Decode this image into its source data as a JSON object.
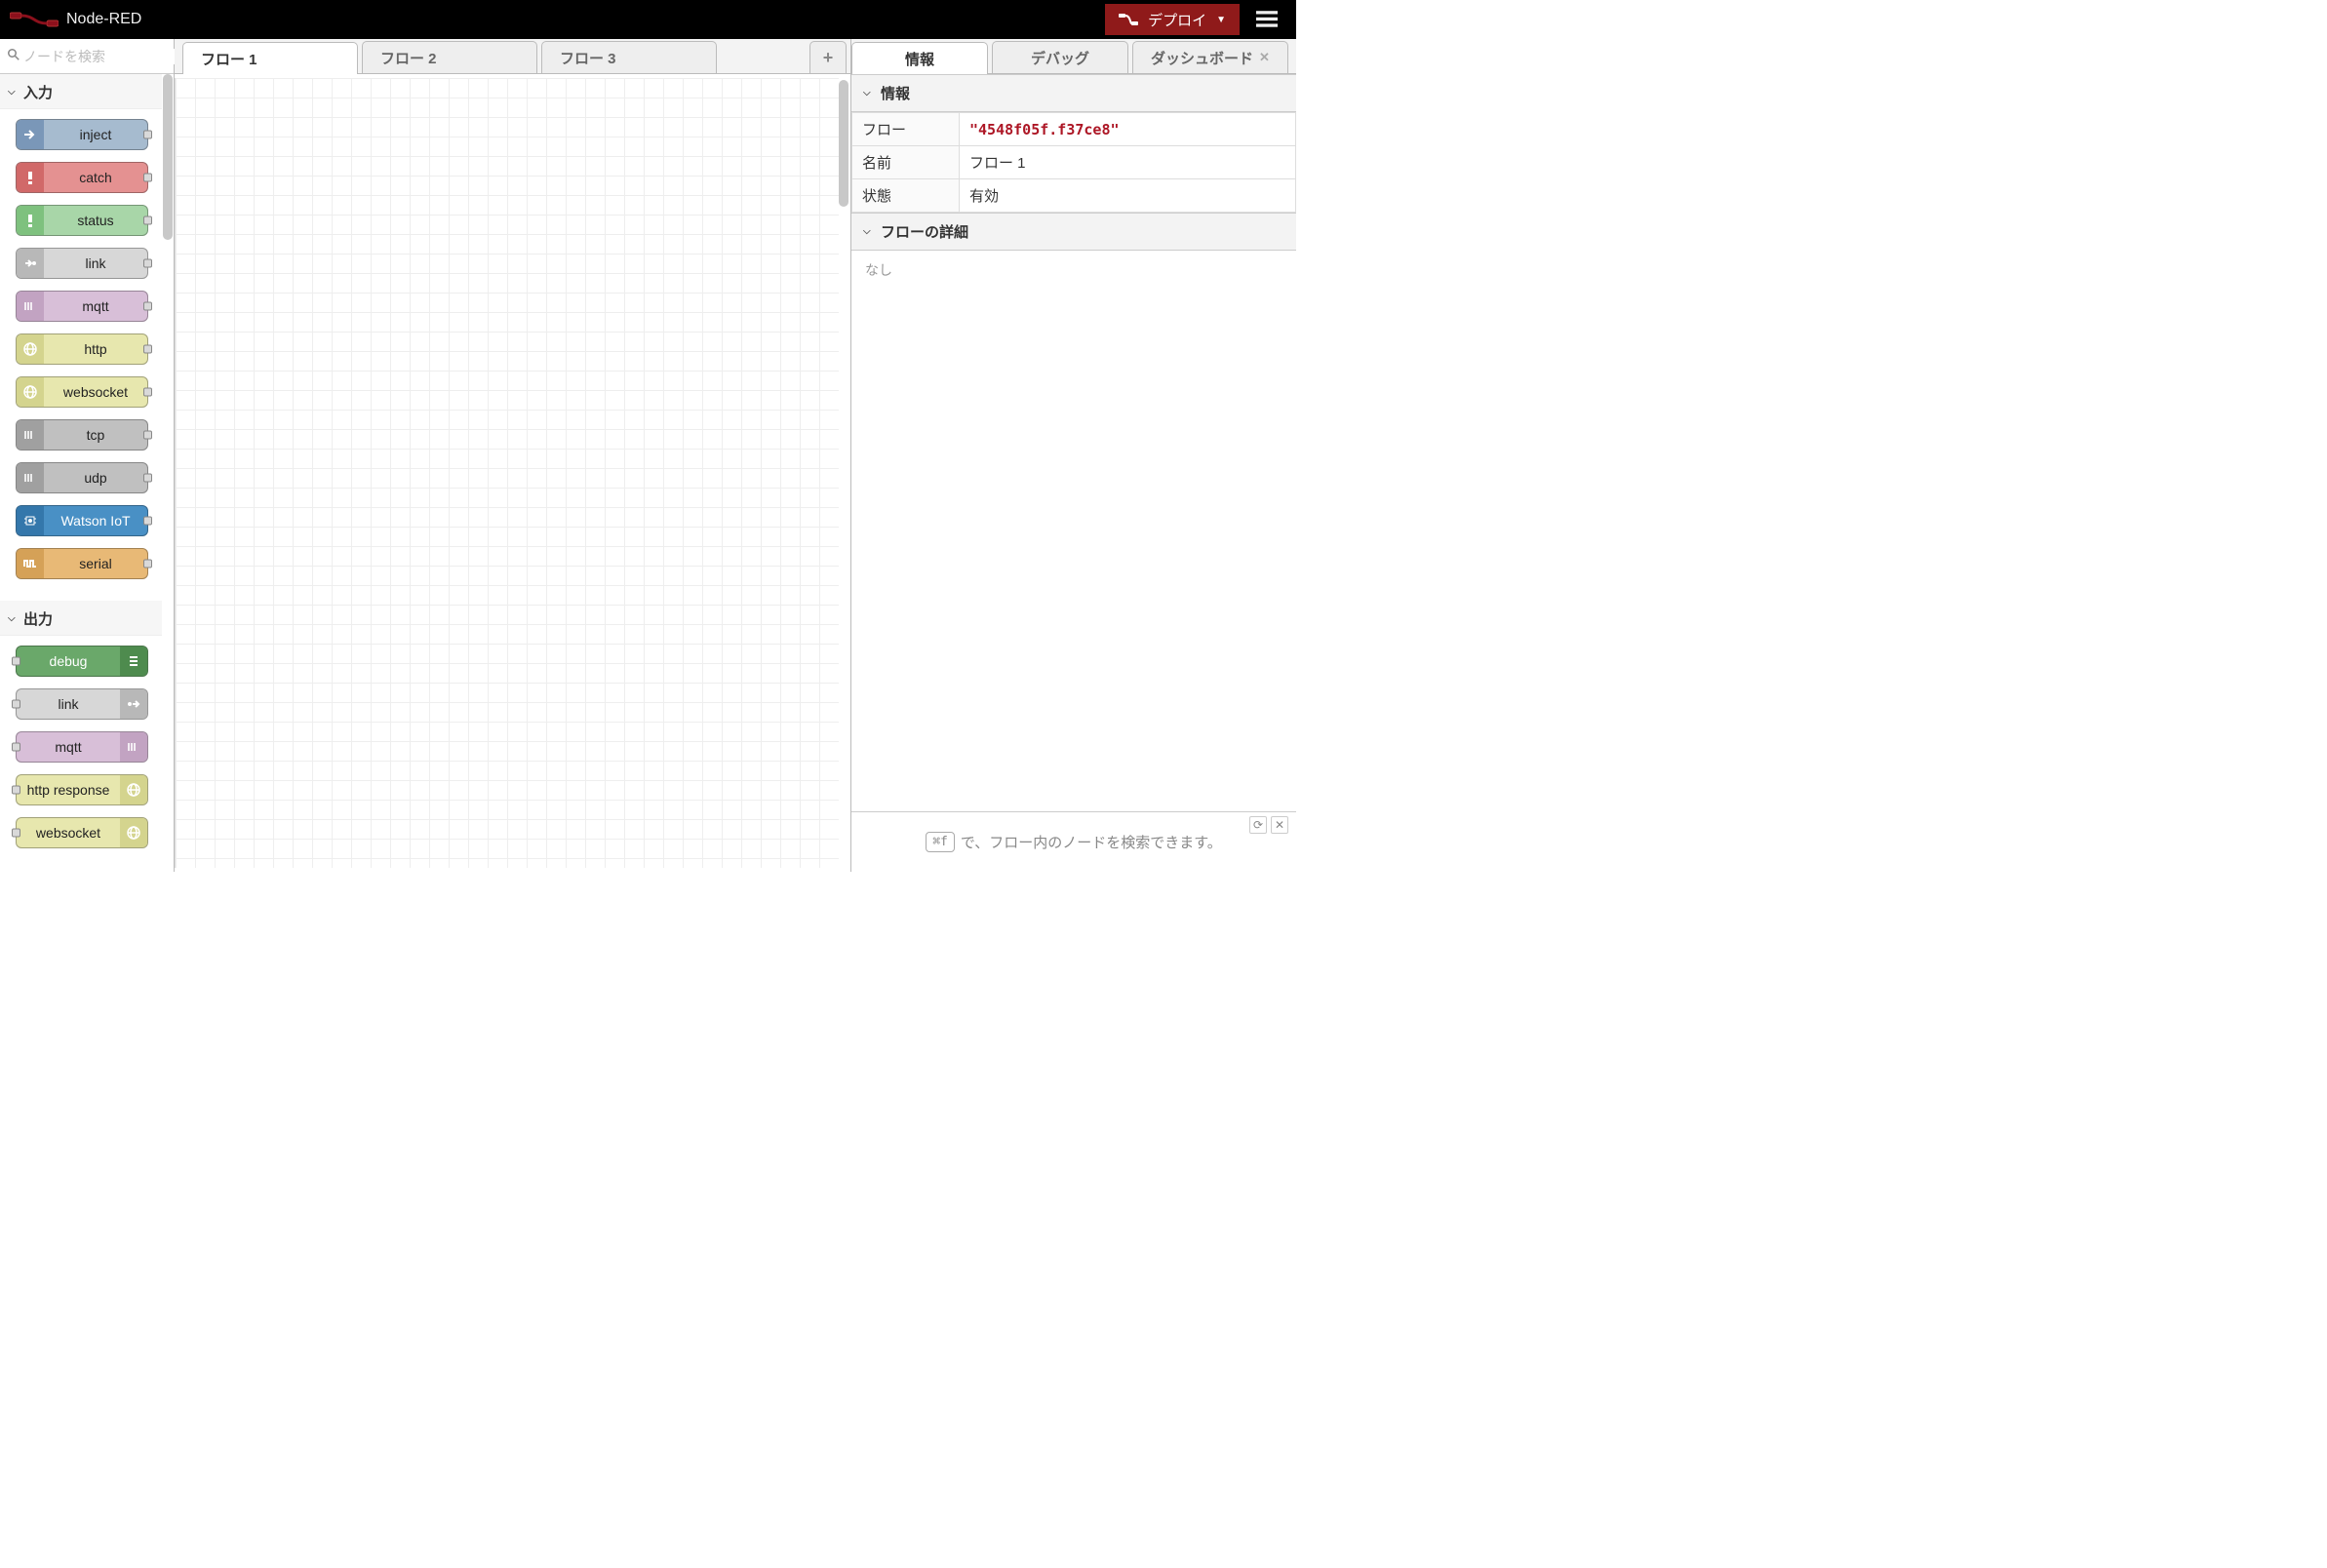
{
  "header": {
    "title": "Node-RED",
    "deploy_label": "デプロイ"
  },
  "palette": {
    "search_placeholder": "ノードを検索",
    "categories": [
      {
        "title": "入力",
        "nodes": [
          {
            "label": "inject",
            "color": "c-blue",
            "icon": "arrow-in",
            "dir": "input"
          },
          {
            "label": "catch",
            "color": "c-red",
            "icon": "alert",
            "dir": "input"
          },
          {
            "label": "status",
            "color": "c-green",
            "icon": "alert",
            "dir": "input"
          },
          {
            "label": "link",
            "color": "c-grey",
            "icon": "link-in",
            "dir": "input"
          },
          {
            "label": "mqtt",
            "color": "c-lilac",
            "icon": "bridge",
            "dir": "input"
          },
          {
            "label": "http",
            "color": "c-olive",
            "icon": "globe",
            "dir": "input"
          },
          {
            "label": "websocket",
            "color": "c-olive",
            "icon": "globe",
            "dir": "input"
          },
          {
            "label": "tcp",
            "color": "c-grey2",
            "icon": "bridge",
            "dir": "input"
          },
          {
            "label": "udp",
            "color": "c-grey2",
            "icon": "bridge",
            "dir": "input"
          },
          {
            "label": "Watson IoT",
            "color": "c-teal",
            "icon": "chip",
            "dir": "input"
          },
          {
            "label": "serial",
            "color": "c-orange",
            "icon": "serial",
            "dir": "input"
          }
        ]
      },
      {
        "title": "出力",
        "nodes": [
          {
            "label": "debug",
            "color": "c-dgreen",
            "icon": "debug",
            "dir": "output"
          },
          {
            "label": "link",
            "color": "c-grey",
            "icon": "link-out",
            "dir": "output"
          },
          {
            "label": "mqtt",
            "color": "c-lilac",
            "icon": "bridge",
            "dir": "output"
          },
          {
            "label": "http response",
            "color": "c-olive",
            "icon": "globe",
            "dir": "output"
          },
          {
            "label": "websocket",
            "color": "c-olive",
            "icon": "globe",
            "dir": "output"
          }
        ]
      }
    ]
  },
  "tabs": [
    "フロー 1",
    "フロー 2",
    "フロー 3"
  ],
  "active_tab": 0,
  "sidebar": {
    "tabs": [
      "情報",
      "デバッグ",
      "ダッシュボード"
    ],
    "active": 0,
    "info_section": "情報",
    "rows": {
      "flow_label": "フロー",
      "flow_id": "\"4548f05f.f37ce8\"",
      "name_label": "名前",
      "name_value": "フロー 1",
      "state_label": "状態",
      "state_value": "有効"
    },
    "detail_section": "フローの詳細",
    "detail_body": "なし",
    "tip_key": "⌘f",
    "tip_text": "で、フロー内のノードを検索できます。"
  }
}
